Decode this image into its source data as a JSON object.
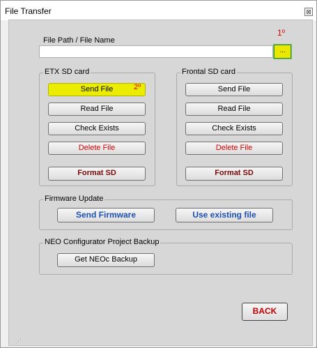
{
  "window": {
    "title": "File Transfer",
    "close_glyph": "⊠"
  },
  "file_path": {
    "label": "File Path / File Name",
    "value": "",
    "browse_label": "...",
    "browse_highlight": "#e8e800",
    "step_marker": "1º"
  },
  "etx_sd": {
    "legend": "ETX SD card",
    "send_label": "Send File",
    "send_highlight": "#ecec00",
    "step_marker": "2º",
    "read_label": "Read File",
    "check_label": "Check Exists",
    "delete_label": "Delete File",
    "format_label": "Format SD"
  },
  "frontal_sd": {
    "legend": "Frontal SD card",
    "send_label": "Send File",
    "read_label": "Read File",
    "check_label": "Check Exists",
    "delete_label": "Delete File",
    "format_label": "Format SD"
  },
  "firmware": {
    "legend": "Firmware Update",
    "send_label": "Send Firmware",
    "existing_label": "Use existing file"
  },
  "backup": {
    "legend": "NEO Configurator Project Backup",
    "get_label": "Get NEOc Backup"
  },
  "footer": {
    "back_label": "BACK"
  },
  "colors": {
    "delete_text": "#d40000",
    "format_text": "#7a0a0a",
    "firmware_text": "#1c4fb0",
    "back_text": "#c00000",
    "step_marker": "#e00000"
  }
}
